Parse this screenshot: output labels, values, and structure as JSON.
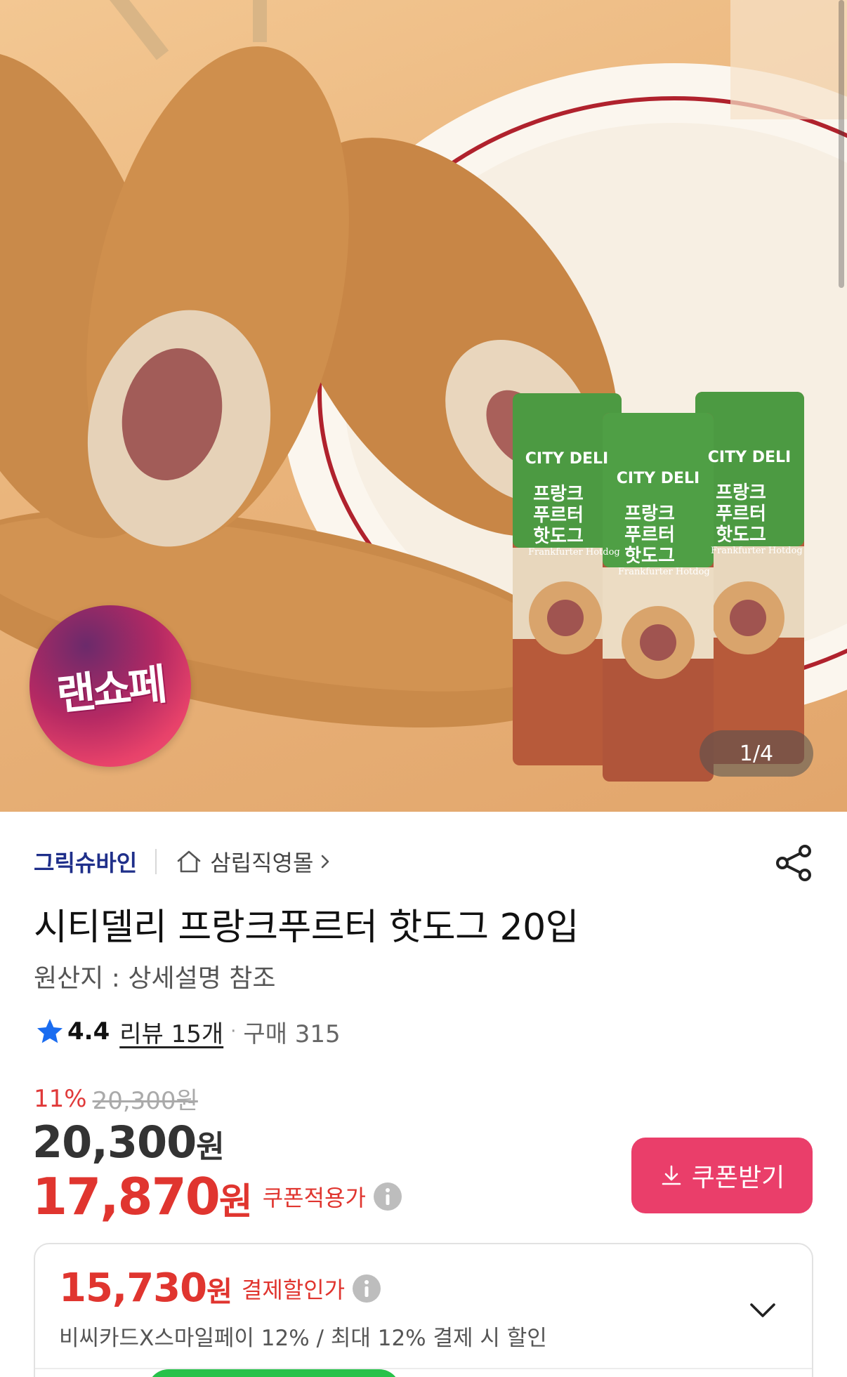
{
  "hero": {
    "badge_text": "랜쇼페",
    "image_counter": "1/4",
    "package_texts": {
      "brand": "CITY DELI",
      "name_line1": "프랑크",
      "name_line2": "푸르터",
      "name_line3": "핫도그",
      "english": "Frankfurter Hotdog"
    }
  },
  "seller": {
    "name": "그릭슈바인",
    "store": "삼립직영몰"
  },
  "product": {
    "title": "시티델리 프랑크푸르터 핫도그 20입",
    "origin": "원산지 : 상세설명 참조"
  },
  "rating": {
    "score": "4.4",
    "review": "리뷰 15개",
    "separator": "·",
    "purchase": "구매 315"
  },
  "price": {
    "discount_rate": "11%",
    "original": "20,300원",
    "sale_number": "20,300",
    "sale_unit": "원",
    "coupon_number": "17,870",
    "coupon_unit": "원",
    "coupon_label": "쿠폰적용가",
    "coupon_button": "쿠폰받기"
  },
  "payment": {
    "price_number": "15,730",
    "price_unit": "원",
    "label": "결제할인가",
    "description": "비씨카드X스마일페이 12% / 최대 12% 결제 시 할인"
  },
  "colors": {
    "seller": "#1f2f8a",
    "discount_red": "#e0352f",
    "coupon_button": "#ea3e6a",
    "star": "#1a6cf0"
  },
  "icons": [
    "home-icon",
    "chevron-right-icon",
    "share-icon",
    "star-icon",
    "info-icon",
    "download-icon",
    "chevron-down-icon"
  ]
}
